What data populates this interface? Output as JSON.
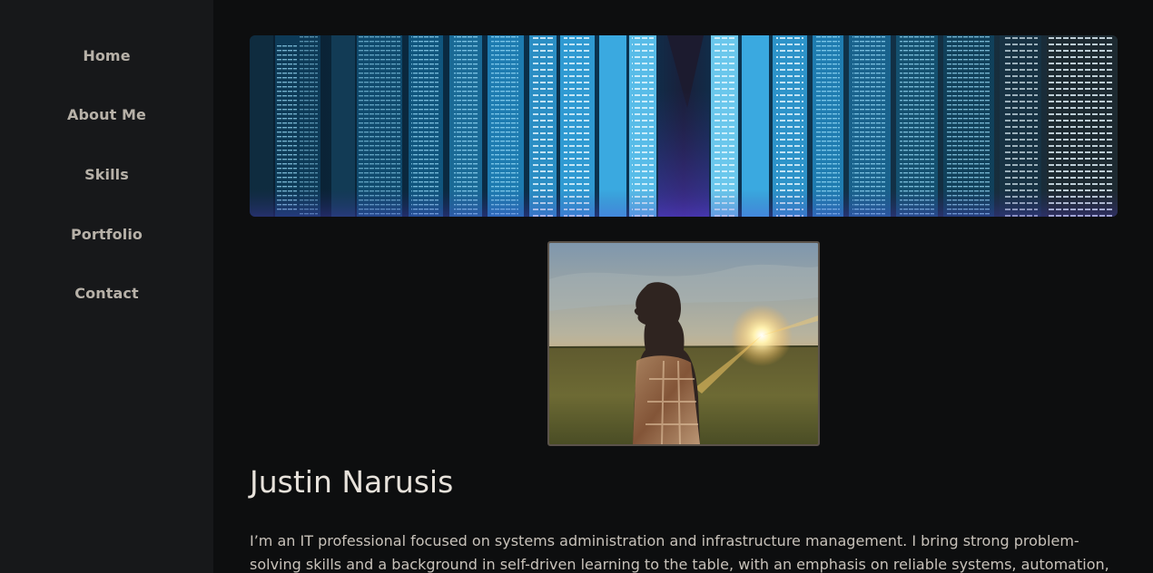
{
  "nav": {
    "items": [
      {
        "label": "Home"
      },
      {
        "label": "About Me"
      },
      {
        "label": "Skills"
      },
      {
        "label": "Portfolio"
      },
      {
        "label": "Contact"
      }
    ]
  },
  "hero": {
    "banner_icon": "data-center-banner-image",
    "portrait_icon": "sunset-portrait-photo"
  },
  "profile": {
    "name": "Justin Narusis",
    "bio": "I’m an IT professional focused on systems administration and infrastructure management. I bring strong problem-solving skills and a background in self-driven learning to the table, with an emphasis on reliable systems, automation, and secure"
  },
  "colors": {
    "sidebar_bg": "#17181a",
    "main_bg": "#0d0e0f",
    "nav_text": "#b7b1a8",
    "heading_text": "#e7e2db"
  }
}
